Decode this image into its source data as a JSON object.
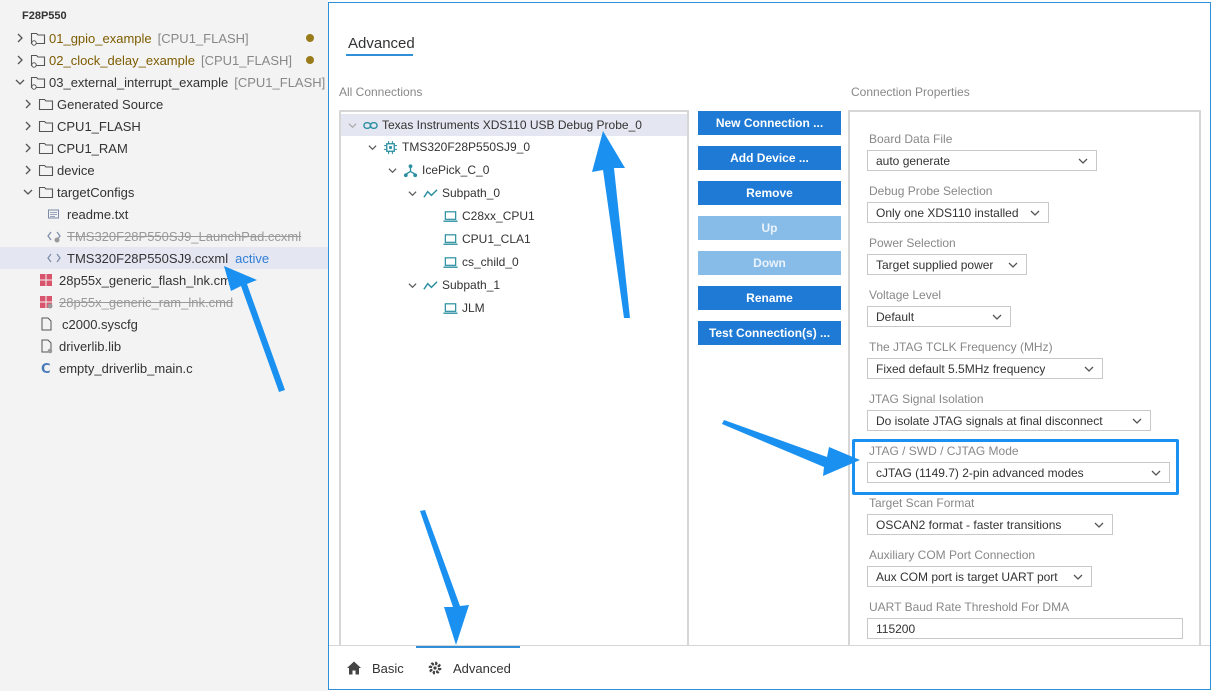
{
  "explorer": {
    "root": "F28P550",
    "items": [
      {
        "label": "01_gpio_example",
        "suffix": "[CPU1_FLASH]"
      },
      {
        "label": "02_clock_delay_example",
        "suffix": "[CPU1_FLASH]"
      },
      {
        "label": "03_external_interrupt_example",
        "suffix": "[CPU1_FLASH]"
      },
      {
        "label": "Generated Source"
      },
      {
        "label": "CPU1_FLASH"
      },
      {
        "label": "CPU1_RAM"
      },
      {
        "label": "device"
      },
      {
        "label": "targetConfigs"
      },
      {
        "label": "readme.txt"
      },
      {
        "label": "TMS320F28P550SJ9_LaunchPad.ccxml"
      },
      {
        "label": "TMS320F28P550SJ9.ccxml",
        "badge": "active"
      },
      {
        "label": "28p55x_generic_flash_lnk.cmd"
      },
      {
        "label": "28p55x_generic_ram_lnk.cmd"
      },
      {
        "label": "c2000.syscfg"
      },
      {
        "label": "driverlib.lib"
      },
      {
        "label": "empty_driverlib_main.c"
      }
    ]
  },
  "editor": {
    "title": "Advanced",
    "all_connections_label": "All Connections",
    "connection_properties_label": "Connection Properties",
    "connections": [
      "Texas Instruments XDS110 USB Debug Probe_0",
      "TMS320F28P550SJ9_0",
      "IcePick_C_0",
      "Subpath_0",
      "C28xx_CPU1",
      "CPU1_CLA1",
      "cs_child_0",
      "Subpath_1",
      "JLM"
    ],
    "buttons": {
      "new_connection": "New Connection ...",
      "add_device": "Add Device ...",
      "remove": "Remove",
      "up": "Up",
      "down": "Down",
      "rename": "Rename",
      "test_connection": "Test Connection(s) ..."
    },
    "properties": [
      {
        "label": "Board Data File",
        "value": "auto generate"
      },
      {
        "label": "Debug Probe Selection",
        "value": "Only one XDS110 installed"
      },
      {
        "label": "Power Selection",
        "value": "Target supplied power"
      },
      {
        "label": "Voltage Level",
        "value": "Default"
      },
      {
        "label": "The JTAG TCLK Frequency (MHz)",
        "value": "Fixed default 5.5MHz frequency"
      },
      {
        "label": "JTAG Signal Isolation",
        "value": "Do isolate JTAG signals at final disconnect"
      },
      {
        "label": "JTAG / SWD / CJTAG Mode",
        "value": "cJTAG (1149.7) 2-pin advanced modes"
      },
      {
        "label": "Target Scan Format",
        "value": "OSCAN2 format - faster transitions"
      },
      {
        "label": "Auxiliary COM Port Connection",
        "value": "Aux COM port is target UART port"
      },
      {
        "label": "UART Baud Rate Threshold For DMA",
        "value": "115200"
      }
    ],
    "bottom_tabs": {
      "basic": "Basic",
      "advanced": "Advanced"
    }
  },
  "colors": {
    "accent": "#1e7ad4",
    "highlight": "#1a91f0",
    "arrow": "#1a91f0"
  }
}
